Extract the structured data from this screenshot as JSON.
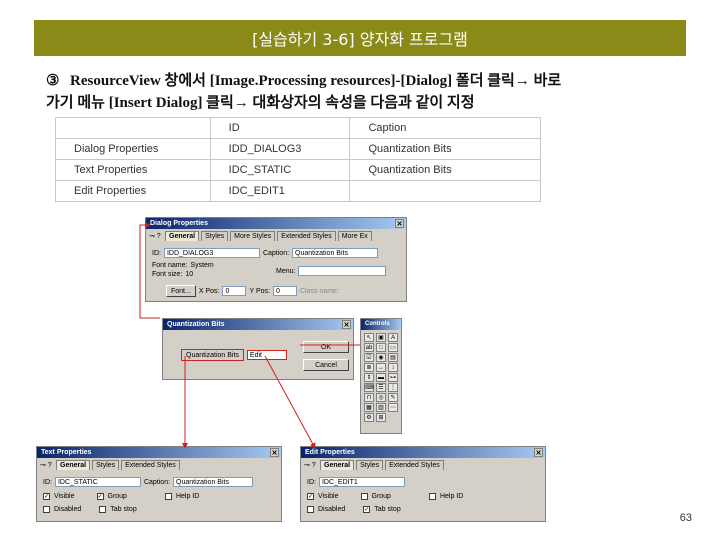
{
  "header": {
    "title": "[실습하기 3-6] 양자화 프로그램"
  },
  "step": {
    "number": "③",
    "line1": "ResourceView 창에서 [Image.Processing resources]-[Dialog] 폴더 클릭→ 바로",
    "line2": "가기 메뉴 [Insert Dialog] 클릭→ 대화상자의 속성을 다음과 같이 지정"
  },
  "table": {
    "headers": [
      "",
      "ID",
      "Caption"
    ],
    "rows": [
      [
        "Dialog Properties",
        "IDD_DIALOG3",
        "Quantization Bits"
      ],
      [
        "Text Properties",
        "IDC_STATIC",
        "Quantization Bits"
      ],
      [
        "Edit Properties",
        "IDC_EDIT1",
        ""
      ]
    ]
  },
  "dialog_props": {
    "title": "Dialog Properties",
    "tabs": [
      "General",
      "Styles",
      "More Styles",
      "Extended Styles",
      "More Ex"
    ],
    "id_label": "ID:",
    "id_value": "IDD_DIALOG3",
    "caption_label": "Caption:",
    "caption_value": "Quantization Bits",
    "font_name_label": "Font name:",
    "font_name_value": "System",
    "font_size_label": "Font size:",
    "font_size_value": "10",
    "menu_label": "Menu:",
    "font_button": "Font...",
    "xpos_label": "X Pos:",
    "xpos_value": "0",
    "ypos_label": "Y Pos:",
    "ypos_value": "0",
    "class_name_label": "Class name:"
  },
  "quant_dialog": {
    "title": "Quantization Bits",
    "label": "Quantization Bits",
    "edit": "Edit",
    "ok": "OK",
    "cancel": "Cancel"
  },
  "controls": {
    "title": "Controls"
  },
  "text_props": {
    "title": "Text Properties",
    "tabs": [
      "General",
      "Styles",
      "Extended Styles"
    ],
    "id_label": "ID:",
    "id_value": "IDC_STATIC",
    "caption_label": "Caption:",
    "caption_value": "Quantization Bits",
    "checks": [
      "Visible",
      "Group",
      "Help ID",
      "Disabled",
      "Tab stop"
    ]
  },
  "edit_props": {
    "title": "Edit Properties",
    "tabs": [
      "General",
      "Styles",
      "Extended Styles"
    ],
    "id_label": "ID:",
    "id_value": "IDC_EDIT1",
    "checks": [
      "Visible",
      "Group",
      "Help ID",
      "Disabled",
      "Tab stop"
    ]
  },
  "page_number": "63",
  "colors": {
    "title_bar": "#8a8a18",
    "arrow": "#d02020"
  }
}
